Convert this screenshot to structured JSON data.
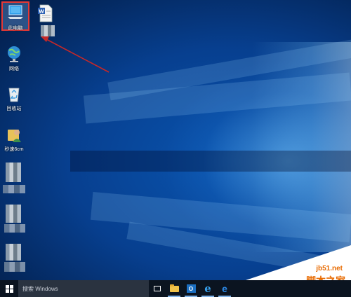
{
  "desktop": {
    "icons": [
      {
        "label": "此电脑",
        "icon": "computer-icon"
      },
      {
        "label": "",
        "icon": "word-document-icon"
      },
      {
        "label": "网络",
        "icon": "network-icon"
      },
      {
        "label": "回收站",
        "icon": "recycle-bin-icon"
      },
      {
        "label": "秒速6cm",
        "icon": "user-folder-icon"
      },
      {
        "label": "",
        "icon": "blurred-icon"
      },
      {
        "label": "",
        "icon": "blurred-icon"
      },
      {
        "label": "",
        "icon": "blurred-icon"
      }
    ]
  },
  "taskbar": {
    "search_placeholder": "搜索 Windows",
    "buttons": [
      {
        "name": "task-view",
        "icon": "task-view-icon"
      },
      {
        "name": "file-explorer",
        "icon": "folder-icon"
      },
      {
        "name": "outlook",
        "icon": "outlook-icon",
        "text": "O"
      },
      {
        "name": "internet-explorer",
        "icon": "ie-icon",
        "text": "e"
      },
      {
        "name": "edge",
        "icon": "edge-icon",
        "text": "e"
      }
    ]
  },
  "watermark": {
    "url": "jb51.net",
    "name": "脚本之家"
  },
  "colors": {
    "highlight_border": "#e53935",
    "arrow": "#c62828",
    "watermark_text": "#e86a00",
    "taskbar": "#0b1420"
  }
}
